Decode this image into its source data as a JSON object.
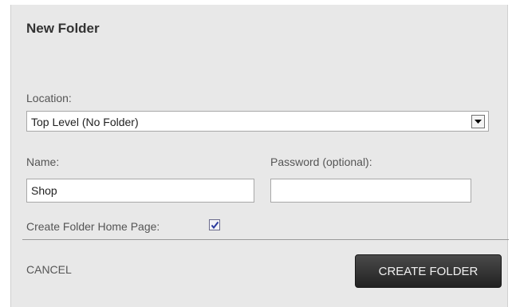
{
  "dialog": {
    "title": "New Folder",
    "location_label": "Location:",
    "location_value": "Top Level (No Folder)",
    "name_label": "Name:",
    "name_value": "Shop",
    "password_label": "Password (optional):",
    "password_value": "",
    "home_page_label": "Create Folder Home Page:",
    "home_page_checked": true,
    "cancel_label": "CANCEL",
    "create_label": "CREATE FOLDER"
  },
  "icons": {
    "dropdown": "chevron-down-icon",
    "check": "checkmark-icon"
  },
  "colors": {
    "panel": "#e8e8e8",
    "button": "#2e2e2e",
    "checkmark": "#2b3a9e"
  }
}
